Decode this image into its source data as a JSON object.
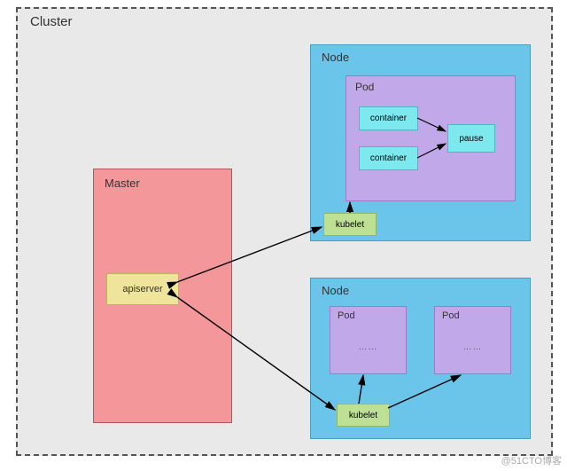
{
  "cluster": {
    "label": "Cluster"
  },
  "master": {
    "label": "Master",
    "apiserver": "apiserver"
  },
  "node1": {
    "label": "Node",
    "pod": {
      "label": "Pod",
      "container1": "container",
      "container2": "container",
      "pause": "pause"
    },
    "kubelet": "kubelet"
  },
  "node2": {
    "label": "Node",
    "pod1": {
      "label": "Pod",
      "ellipsis": "……"
    },
    "pod2": {
      "label": "Pod",
      "ellipsis": "……"
    },
    "kubelet": "kubelet"
  },
  "watermark": "@51CTO博客"
}
